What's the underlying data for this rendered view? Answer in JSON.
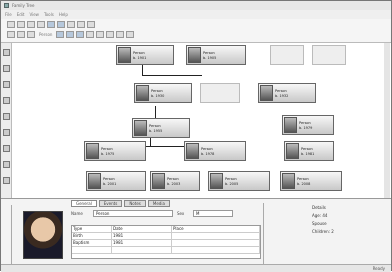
{
  "window": {
    "title": "Family Tree"
  },
  "menu": [
    "File",
    "Edit",
    "View",
    "Tools",
    "Help"
  ],
  "toolbar": {
    "label": "Person"
  },
  "tree": {
    "people": [
      {
        "id": "p1",
        "name": "Person",
        "info": "b. 1901"
      },
      {
        "id": "p2",
        "name": "Person",
        "info": "b. 1905"
      },
      {
        "id": "p3",
        "name": "Person",
        "info": "b. 1930"
      },
      {
        "id": "p4",
        "name": "Person",
        "info": "b. 1932"
      },
      {
        "id": "p5",
        "name": "Person",
        "info": "b. 1955"
      },
      {
        "id": "p6",
        "name": "Person",
        "info": "b. 1975"
      },
      {
        "id": "p7",
        "name": "Person",
        "info": "b. 1978"
      },
      {
        "id": "p8",
        "name": "Person",
        "info": "b. 1981"
      },
      {
        "id": "p9",
        "name": "Person",
        "info": "b. 1983"
      },
      {
        "id": "p10",
        "name": "Person",
        "info": "b. 1979"
      },
      {
        "id": "p11",
        "name": "Person",
        "info": "b. 2001"
      },
      {
        "id": "p12",
        "name": "Person",
        "info": "b. 2003"
      },
      {
        "id": "p13",
        "name": "Person",
        "info": "b. 2005"
      },
      {
        "id": "p14",
        "name": "Person",
        "info": "b. 2008"
      }
    ]
  },
  "details": {
    "tabs": [
      "General",
      "Events",
      "Notes",
      "Media"
    ],
    "labels": {
      "name": "Name",
      "birth": "Birth",
      "death": "Death",
      "sex": "Sex"
    },
    "values": {
      "name": "Person",
      "birth": "1981",
      "death": "",
      "sex": "M"
    },
    "grid": [
      [
        "Type",
        "Date",
        "Place"
      ],
      [
        "Birth",
        "1981",
        ""
      ],
      [
        "Baptism",
        "1981",
        ""
      ],
      [
        "",
        "",
        ""
      ]
    ],
    "right": {
      "title": "Details",
      "rows": [
        "Age: 44",
        "Spouse",
        "Children: 2"
      ]
    }
  },
  "status": {
    "text": "Ready"
  }
}
